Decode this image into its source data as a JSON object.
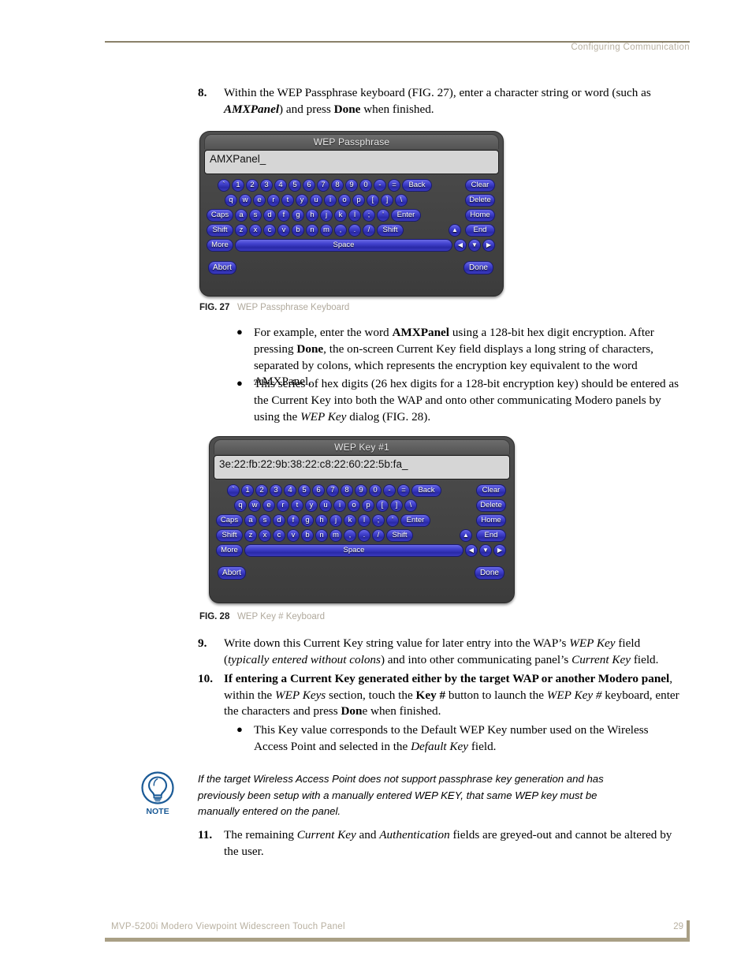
{
  "header": {
    "section_title": "Configuring Communication"
  },
  "footer": {
    "doc_title": "MVP-5200i Modero Viewpoint Widescreen Touch Panel",
    "page_number": "29"
  },
  "steps": {
    "step8": {
      "number": "8.",
      "text_parts": [
        {
          "t": "Within the WEP Passphrase keyboard (FIG. 27), enter a character string or word (such as ",
          "s": "n"
        },
        {
          "t": "AMXPanel",
          "s": "bi"
        },
        {
          "t": ") and press ",
          "s": "n"
        },
        {
          "t": "Done",
          "s": "b"
        },
        {
          "t": " when finished.",
          "s": "n"
        }
      ]
    },
    "step9": {
      "number": "9.",
      "text_parts": [
        {
          "t": "Write down this Current Key string value for later entry into the WAP’s ",
          "s": "n"
        },
        {
          "t": "WEP Key",
          "s": "i"
        },
        {
          "t": " field (",
          "s": "n"
        },
        {
          "t": "typically entered without colons",
          "s": "i"
        },
        {
          "t": ") and into other communicating panel’s ",
          "s": "n"
        },
        {
          "t": "Current Key",
          "s": "i"
        },
        {
          "t": " field.",
          "s": "n"
        }
      ]
    },
    "step10": {
      "number": "10.",
      "text_parts": [
        {
          "t": "If entering a Current Key generated either by the target WAP or another Modero panel",
          "s": "b"
        },
        {
          "t": ", within the ",
          "s": "n"
        },
        {
          "t": "WEP Keys",
          "s": "i"
        },
        {
          "t": " section, touch the ",
          "s": "n"
        },
        {
          "t": "Key #",
          "s": "b"
        },
        {
          "t": " button to launch the ",
          "s": "n"
        },
        {
          "t": "WEP Key #",
          "s": "i"
        },
        {
          "t": " keyboard, enter the characters and press ",
          "s": "n"
        },
        {
          "t": "Don",
          "s": "b"
        },
        {
          "t": "e when finished.",
          "s": "n"
        }
      ]
    },
    "step11": {
      "number": "11.",
      "text_parts": [
        {
          "t": "The remaining ",
          "s": "n"
        },
        {
          "t": "Current Key",
          "s": "i"
        },
        {
          "t": " and ",
          "s": "n"
        },
        {
          "t": "Authentication",
          "s": "i"
        },
        {
          "t": " fields are greyed-out and cannot be altered by the user.",
          "s": "n"
        }
      ]
    }
  },
  "bullets": {
    "b1": {
      "marker": "●",
      "text_parts": [
        {
          "t": "For example, enter the word ",
          "s": "n"
        },
        {
          "t": "AMXPanel",
          "s": "b"
        },
        {
          "t": " using a 128-bit hex digit encryption. After pressing ",
          "s": "n"
        },
        {
          "t": "Done",
          "s": "b"
        },
        {
          "t": ", the on-screen Current Key field displays a long string of characters, separated by colons, which represents the encryption key equivalent to the word AMXPanel.",
          "s": "n"
        }
      ]
    },
    "b2": {
      "marker": "●",
      "text_parts": [
        {
          "t": "This series of hex digits (26 hex digits for a 128-bit encryption key) should be entered as the Current Key into both the WAP and onto other communicating Modero panels by using the ",
          "s": "n"
        },
        {
          "t": "WEP Key",
          "s": "i"
        },
        {
          "t": " dialog (FIG. 28).",
          "s": "n"
        }
      ]
    },
    "b3": {
      "marker": "●",
      "text_parts": [
        {
          "t": "This Key value corresponds to the Default WEP Key number used on the Wireless Access Point and selected in the ",
          "s": "n"
        },
        {
          "t": "Default Key",
          "s": "i"
        },
        {
          "t": " field.",
          "s": "n"
        }
      ]
    }
  },
  "note": {
    "icon_label": "NOTE",
    "text": "If the target Wireless Access Point does not support passphrase key generation and has previously been setup with a manually entered WEP KEY, that same WEP key must be manually entered on the panel.",
    "accent_color": "#1a5a96"
  },
  "figures": {
    "fig27": {
      "label": "FIG. 27",
      "caption": "WEP Passphrase Keyboard"
    },
    "fig28": {
      "label": "FIG. 28",
      "caption": "WEP Key # Keyboard"
    }
  },
  "keyboard1": {
    "title": "WEP Passphrase",
    "input_value": "AMXPanel_",
    "abort_label": "Abort",
    "done_label": "Done",
    "rows": [
      {
        "left": [
          "`",
          "1",
          "2",
          "3",
          "4",
          "5",
          "6",
          "7",
          "8",
          "9",
          "0",
          "-",
          "=",
          "Back"
        ],
        "wide": [
          "Back"
        ],
        "right": [
          "Clear"
        ]
      },
      {
        "indent": 9,
        "left": [
          "q",
          "w",
          "e",
          "r",
          "t",
          "y",
          "u",
          "i",
          "o",
          "p",
          "[",
          "]",
          "\\"
        ],
        "wide": [],
        "right": [
          "Delete"
        ]
      },
      {
        "left": [
          "Caps",
          "a",
          "s",
          "d",
          "f",
          "g",
          "h",
          "j",
          "k",
          "l",
          ";",
          "'",
          "Enter"
        ],
        "wide": [
          "Caps",
          "Enter"
        ],
        "right": [
          "Home"
        ]
      },
      {
        "left": [
          "Shift",
          "z",
          "x",
          "c",
          "v",
          "b",
          "n",
          "m",
          ",",
          ".",
          "/",
          "Shift"
        ],
        "wide": [
          "Shift"
        ],
        "right": [
          "▲",
          "End"
        ]
      },
      {
        "left": [
          "More",
          "Space"
        ],
        "wide": [
          "More"
        ],
        "right": [
          "◀",
          "▼",
          "▶"
        ]
      }
    ]
  },
  "keyboard2": {
    "title": "WEP Key #1",
    "input_value": "3e:22:fb:22:9b:38:22:c8:22:60:22:5b:fa_",
    "abort_label": "Abort",
    "done_label": "Done"
  },
  "colors": {
    "key_blue": "#3232bb",
    "panel_gray": "#454545",
    "input_gray": "#d6d6d6",
    "rule_tan": "#8a8169",
    "footer_tan": "#a99f85"
  }
}
